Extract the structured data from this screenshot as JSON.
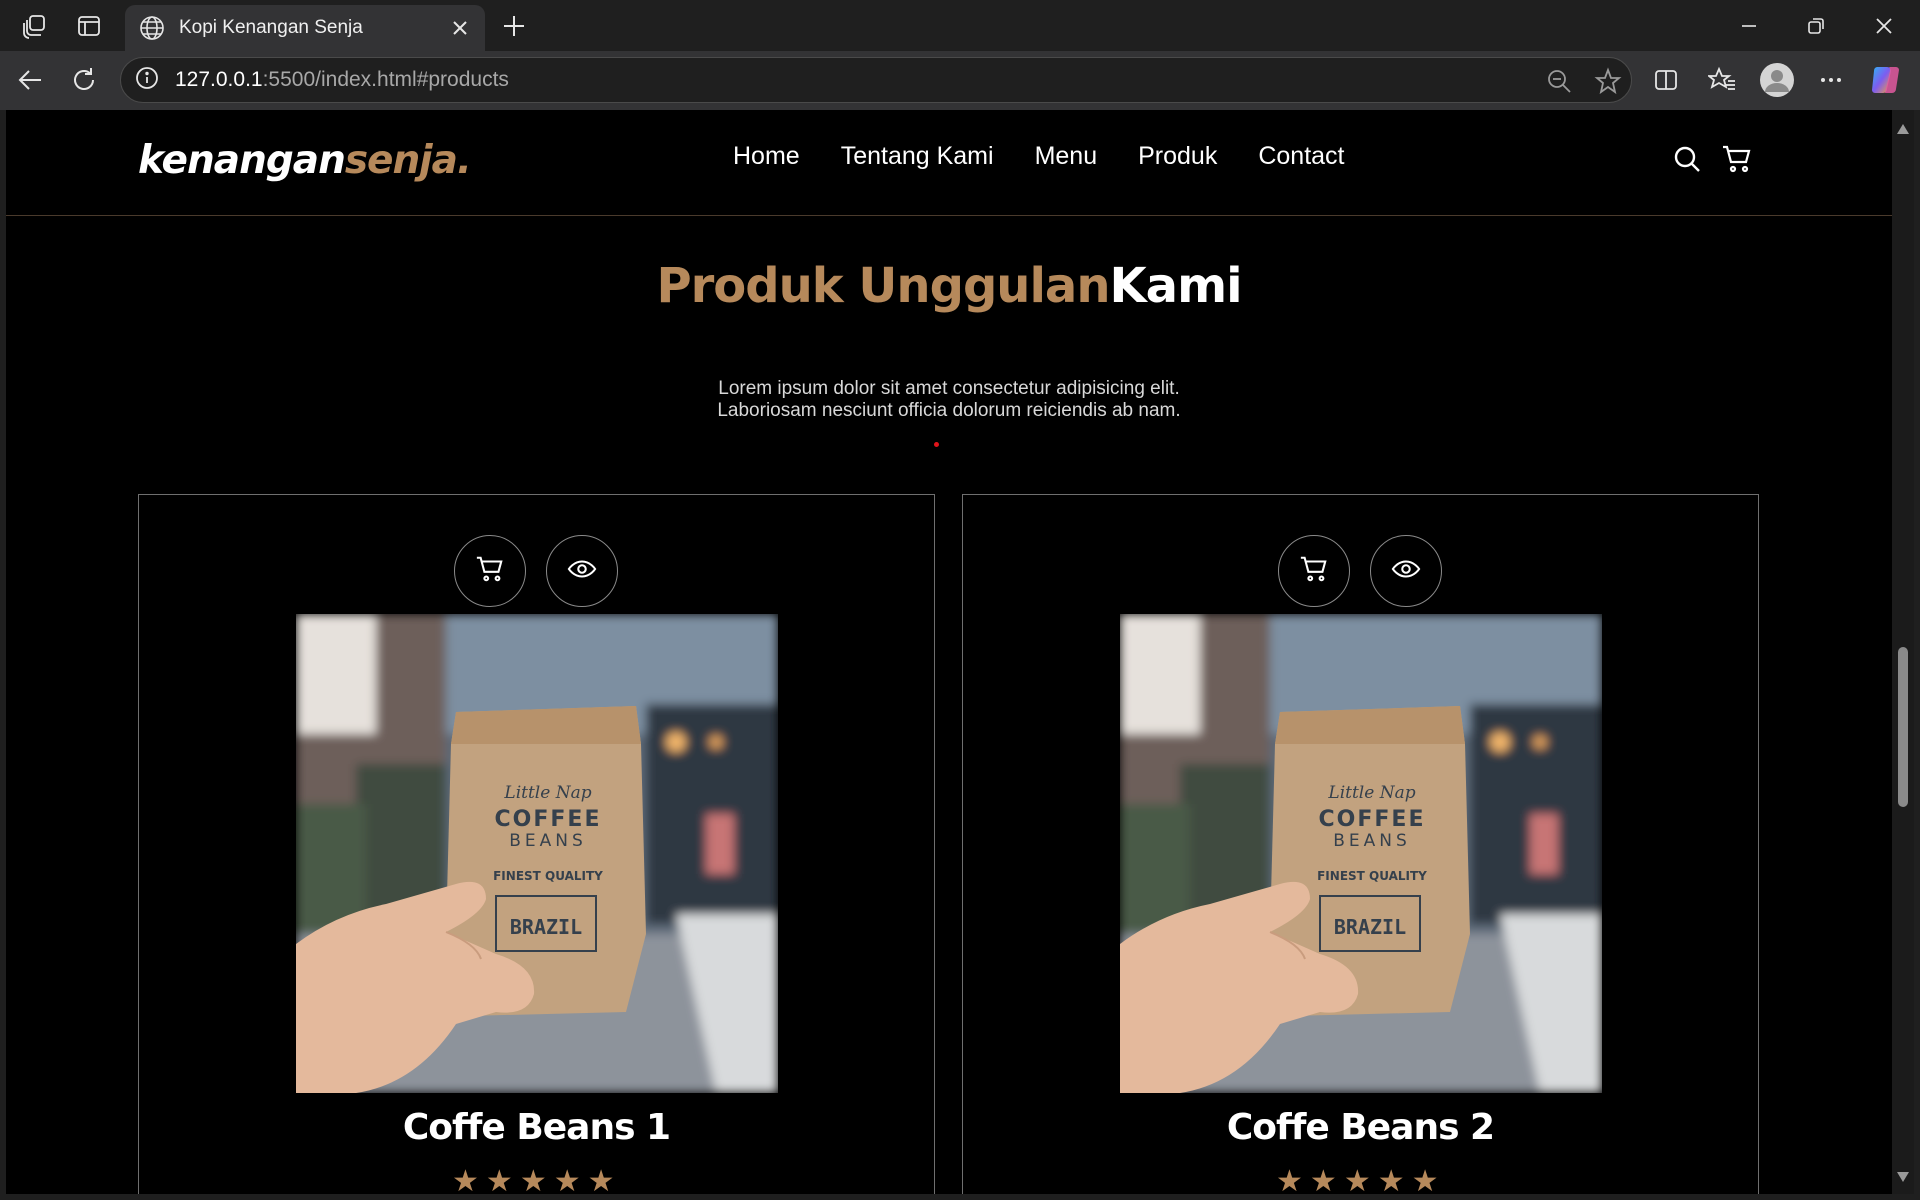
{
  "browser": {
    "tab_title": "Kopi Kenangan Senja",
    "url_host": "127.0.0.1",
    "url_path": ":5500/index.html#products"
  },
  "site": {
    "logo_main": "kenangan",
    "logo_accent": "senja.",
    "accent_color": "#b6895b",
    "nav": [
      "Home",
      "Tentang Kami",
      "Menu",
      "Produk",
      "Contact"
    ]
  },
  "section": {
    "title_accent": "Produk Unggulan",
    "title_plain": "Kami",
    "desc_line1": "Lorem ipsum dolor sit amet consectetur adipisicing elit.",
    "desc_line2": "Laboriosam nesciunt officia dolorum reiciendis ab nam."
  },
  "products": [
    {
      "name": "Coffe Beans 1",
      "rating": 5
    },
    {
      "name": "Coffe Beans 2",
      "rating": 5
    }
  ],
  "coffee_bag": {
    "brand": "Little Nap",
    "line1": "COFFEE",
    "line2": "BEANS",
    "quality": "FINEST QUALITY",
    "origin": "BRAZIL"
  }
}
